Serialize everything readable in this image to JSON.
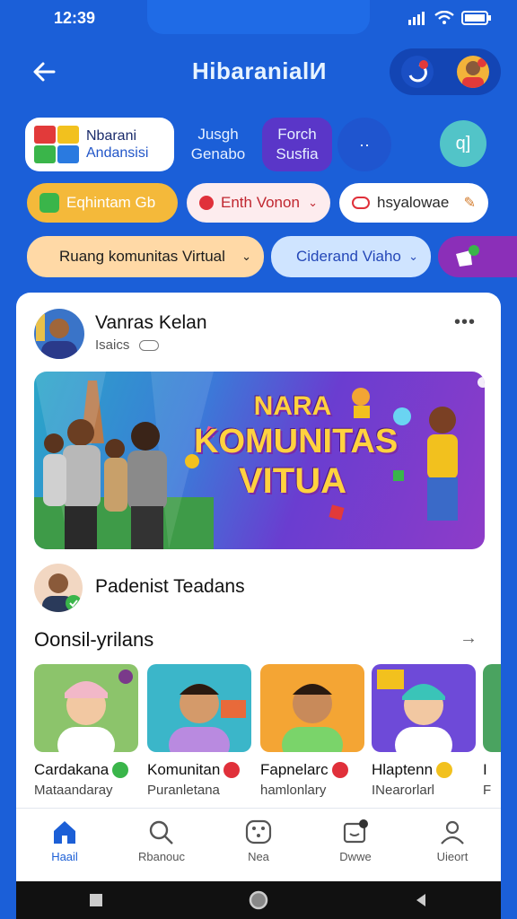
{
  "status": {
    "time": "12:39"
  },
  "header": {
    "title": "HibaranialИ"
  },
  "top_row": {
    "brand_line1": "Nbarani",
    "brand_line2": "Andansisi",
    "tab1": [
      "Jusgh",
      "Genabo"
    ],
    "tab2": [
      "Forch",
      "Susfia"
    ],
    "dots": "··",
    "q_label": "q]"
  },
  "chips": [
    {
      "label": "Eqhintam Gb",
      "bg": "#f4b93a",
      "color": "#fff"
    },
    {
      "label": "Enth Vonon",
      "bg": "#fde8e8",
      "color": "#c0262f"
    },
    {
      "label": "hsyalowae",
      "bg": "#ffffff",
      "color": "#c0262f"
    }
  ],
  "chips2": [
    {
      "label": "Ruang komunitas Virtual",
      "bg": "#ffd9a6",
      "color": "#1d1d1d"
    },
    {
      "label": "Ciderand Viaho",
      "bg": "#cfe4ff",
      "color": "#2548b8"
    }
  ],
  "post": {
    "name": "Vanras Kelan",
    "sub": "Isaics",
    "more": "•••",
    "banner_line1": "NARA",
    "banner_line2": "KOMUNITAS",
    "banner_line3": "VITUA"
  },
  "sub_post": {
    "name": "Padenist Teadans"
  },
  "section": {
    "title": "Oonsil-yrilans",
    "arrow": "→"
  },
  "cards": [
    {
      "name": "Cardakana",
      "sub": "Mataandaray",
      "badge": "#3ab54a",
      "bg": "#8cc46b"
    },
    {
      "name": "Komunitan",
      "sub": "Puranletana",
      "badge": "#e0303a",
      "bg": "#3bb6c9"
    },
    {
      "name": "Fapnelarc",
      "sub": "hamlonlary",
      "badge": "#e0303a",
      "bg": "#f4a534"
    },
    {
      "name": "Hlaptenn",
      "sub": "INearorlarl",
      "badge": "#f2c11e",
      "bg": "#6e4ad8"
    },
    {
      "name": "I",
      "sub": "F",
      "badge": "#fff",
      "bg": "#4aa360"
    }
  ],
  "nav": [
    {
      "label": "Haail",
      "icon": "home-icon"
    },
    {
      "label": "Rbanouc",
      "icon": "search-icon"
    },
    {
      "label": "Nea",
      "icon": "dice-icon"
    },
    {
      "label": "Dwwe",
      "icon": "message-icon"
    },
    {
      "label": "Uieort",
      "icon": "profile-icon"
    }
  ],
  "colors": {
    "primary": "#1b5fd8",
    "active_tab": "#5a36c8"
  }
}
